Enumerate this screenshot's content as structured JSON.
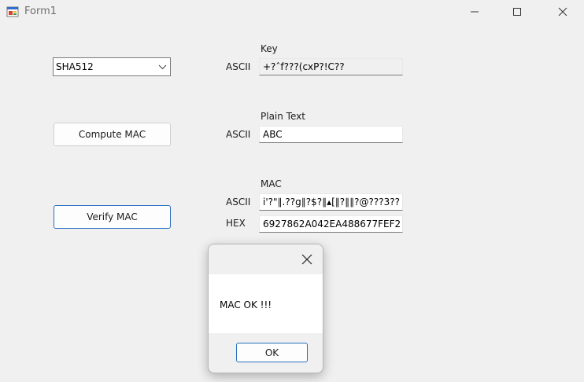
{
  "window": {
    "title": "Form1"
  },
  "algorithm": {
    "selected": "SHA512"
  },
  "buttons": {
    "compute": "Compute MAC",
    "verify": "Verify MAC"
  },
  "key": {
    "heading": "Key",
    "ascii_label": "ASCII",
    "ascii_value": "+?ˆf???(cxP?!C??"
  },
  "plain": {
    "heading": "Plain Text",
    "ascii_label": "ASCII",
    "ascii_value": "ABC"
  },
  "mac": {
    "heading": "MAC",
    "ascii_label": "ASCII",
    "ascii_value": "i'?\"∥.??g∥?$?∥▴[∥?∥∥?@???3??",
    "hex_label": "HEX",
    "hex_value": "6927862A042EA488677FEF2"
  },
  "dialog": {
    "message": "MAC OK !!!",
    "ok_label": "OK"
  }
}
